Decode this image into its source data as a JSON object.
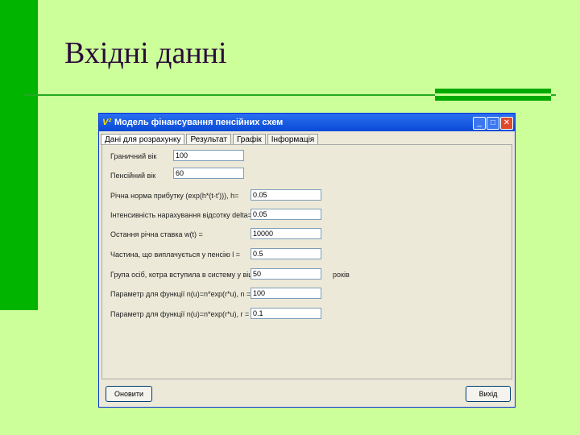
{
  "slide": {
    "title": "Вхідні данні"
  },
  "window": {
    "title": "Модель фінансування пенсійних схем",
    "tabs": [
      "Дані для розрахунку",
      "Результат",
      "Графік",
      "Інформація"
    ],
    "fields": [
      {
        "label": "Граничний вік",
        "value": "100"
      },
      {
        "label": "Пенсійний вік",
        "value": "60"
      },
      {
        "label": "Річна норма прибутку (exp(h*(t-t'))), h=",
        "value": "0.05"
      },
      {
        "label": "Інтенсивність нарахування відсотку delta=",
        "value": "0.05"
      },
      {
        "label": "Остання річна ставка w(t) =",
        "value": "10000"
      },
      {
        "label": "Частина, що виплачується у пенсію l =",
        "value": "0.5"
      },
      {
        "label": "Група осіб, котра вступила в систему у віці a =",
        "value": "50",
        "unit": "років"
      },
      {
        "label": "Параметр для функції n(u)=n*exp(r*u), n =",
        "value": "100"
      },
      {
        "label": "Параметр для функції n(u)=n*exp(r*u), r =",
        "value": "0.1"
      }
    ],
    "buttons": {
      "update": "Оновити",
      "exit": "Вихід"
    }
  }
}
